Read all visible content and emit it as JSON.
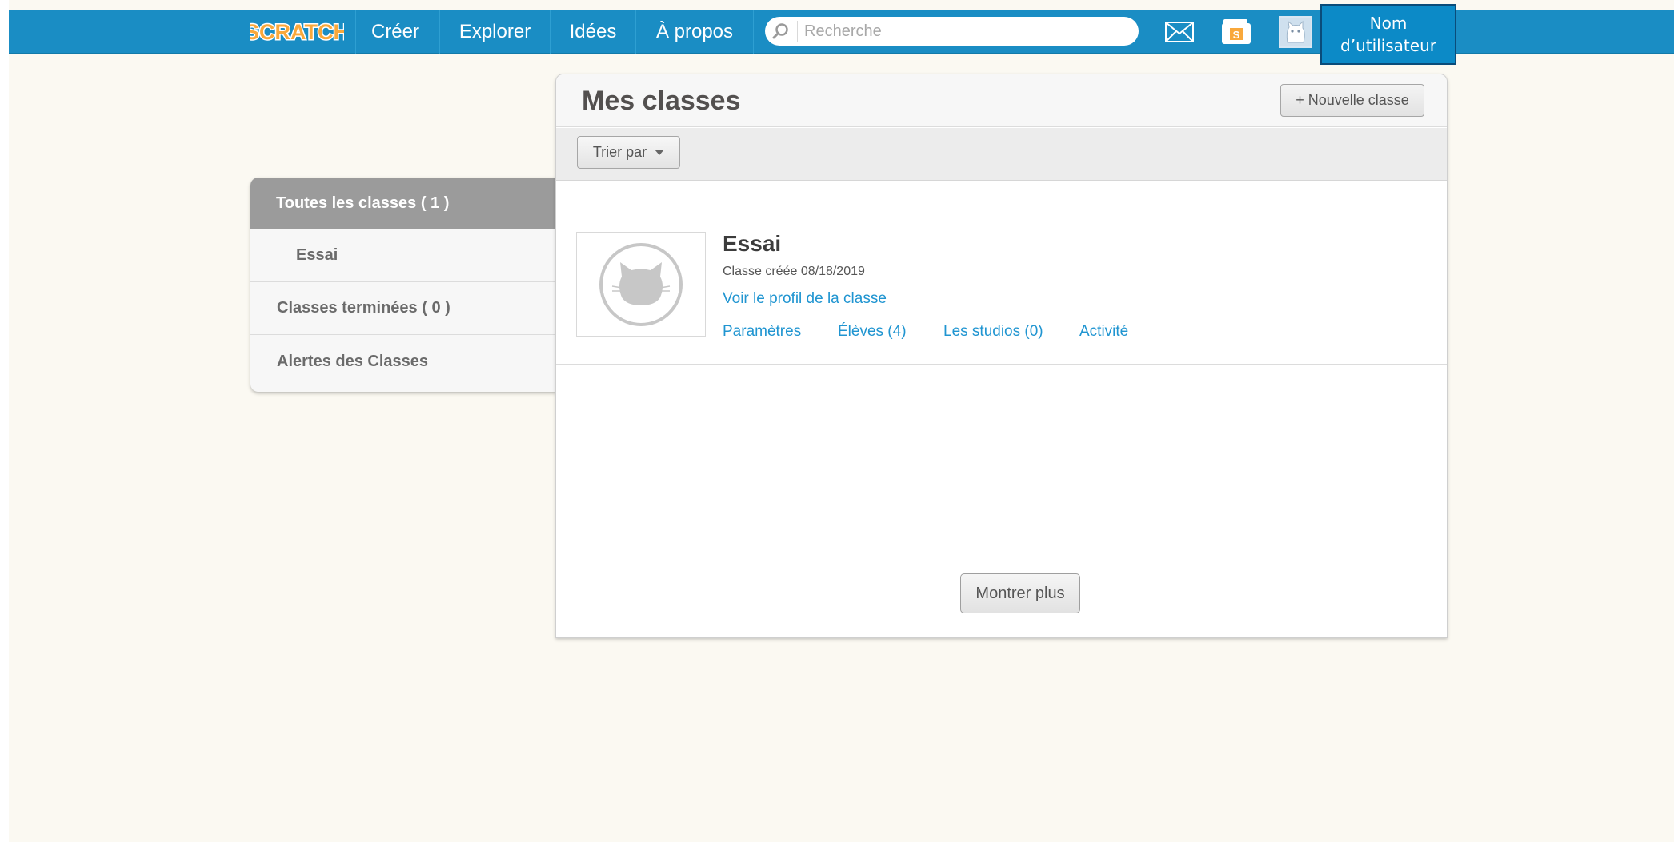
{
  "nav": {
    "logo_text": "SCRATCH",
    "items": [
      {
        "label": "Créer"
      },
      {
        "label": "Explorer"
      },
      {
        "label": "Idées"
      },
      {
        "label": "À propos"
      }
    ],
    "search_placeholder": "Recherche",
    "icons": [
      "messages-icon",
      "my-stuff-icon",
      "avatar"
    ],
    "my_stuff_badge": "S",
    "username_line1": "Nom",
    "username_line2": "d’utilisateur"
  },
  "sidebar": {
    "items": [
      {
        "label": "Toutes les classes ( 1 )",
        "active": true
      },
      {
        "label": "Essai"
      },
      {
        "label": "Classes terminées ( 0 )"
      },
      {
        "label": "Alertes des Classes"
      }
    ]
  },
  "panel": {
    "title": "Mes classes",
    "new_class_label": "+ Nouvelle classe",
    "sort_label": "Trier par",
    "classes": [
      {
        "name": "Essai",
        "created": "Classe créée 08/18/2019",
        "profile_link": "Voir le profil de la classe",
        "links": [
          "Paramètres",
          "Élèves (4)",
          "Les studios (0)",
          "Activité"
        ]
      }
    ],
    "more_label": "Montrer plus"
  },
  "colors": {
    "nav_blue": "#1a8dc4",
    "link_blue": "#2095d1",
    "sidebar_active": "#9b9b9b",
    "background": "#fbf9f2"
  }
}
